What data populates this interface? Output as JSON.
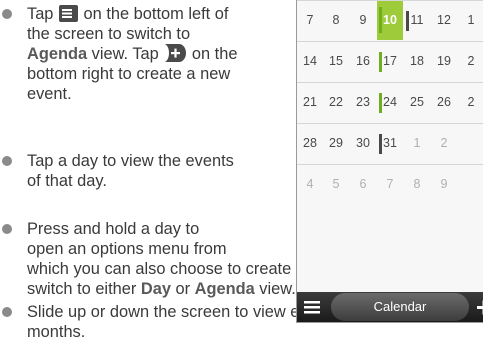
{
  "bullets": [
    {
      "lines": [
        {
          "parts": [
            {
              "t": "Tap "
            },
            {
              "icon": "menu-icon"
            },
            {
              "t": " on the bottom left of"
            }
          ]
        },
        {
          "parts": [
            {
              "t": "the screen to switch to"
            }
          ]
        },
        {
          "parts": [
            {
              "t": "Agenda",
              "b": true
            },
            {
              "t": " view. Tap "
            },
            {
              "icon": "plus-icon"
            },
            {
              "t": " on the"
            }
          ]
        },
        {
          "parts": [
            {
              "t": "bottom right to create a new"
            }
          ]
        },
        {
          "parts": [
            {
              "t": "event."
            }
          ]
        }
      ]
    },
    {
      "lines": [
        {
          "parts": [
            {
              "t": "Tap a day to view the events"
            }
          ]
        },
        {
          "parts": [
            {
              "t": "of that day."
            }
          ]
        }
      ]
    },
    {
      "lines": [
        {
          "parts": [
            {
              "t": "Press and hold a day to"
            }
          ]
        },
        {
          "parts": [
            {
              "t": "open an options menu from"
            }
          ]
        },
        {
          "parts": [
            {
              "t": "which you can also choose to create an event or"
            }
          ],
          "outdent": true
        },
        {
          "parts": [
            {
              "t": "switch to either "
            },
            {
              "t": "Day",
              "b": true
            },
            {
              "t": " or "
            },
            {
              "t": "Agenda",
              "b": true
            },
            {
              "t": " view."
            }
          ],
          "outdent": true
        }
      ]
    },
    {
      "lines": [
        {
          "parts": [
            {
              "t": "Slide up or down the screen to view earlier or later"
            }
          ]
        },
        {
          "parts": [
            {
              "t": "months."
            }
          ]
        }
      ]
    }
  ],
  "calendar": {
    "rows": [
      {
        "cells": [
          {
            "d": "7"
          },
          {
            "d": "8"
          },
          {
            "d": "9"
          },
          {
            "d": "10",
            "today": true,
            "ev": "green"
          },
          {
            "d": "11",
            "ev": "dark"
          },
          {
            "d": "12"
          },
          {
            "d": "1"
          }
        ]
      },
      {
        "cells": [
          {
            "d": "14"
          },
          {
            "d": "15"
          },
          {
            "d": "16"
          },
          {
            "d": "17",
            "ev": "green"
          },
          {
            "d": "18"
          },
          {
            "d": "19"
          },
          {
            "d": "2"
          }
        ]
      },
      {
        "cells": [
          {
            "d": "21"
          },
          {
            "d": "22"
          },
          {
            "d": "23"
          },
          {
            "d": "24",
            "ev": "green"
          },
          {
            "d": "25"
          },
          {
            "d": "26"
          },
          {
            "d": "2"
          }
        ]
      },
      {
        "cells": [
          {
            "d": "28"
          },
          {
            "d": "29"
          },
          {
            "d": "30"
          },
          {
            "d": "31",
            "ev": "dark"
          },
          {
            "d": "1",
            "dim": true
          },
          {
            "d": "2",
            "dim": true
          },
          {
            "d": "",
            "dim": true
          }
        ]
      },
      {
        "cells": [
          {
            "d": "4",
            "dim": true
          },
          {
            "d": "5",
            "dim": true
          },
          {
            "d": "6",
            "dim": true
          },
          {
            "d": "7",
            "dim": true
          },
          {
            "d": "8",
            "dim": true
          },
          {
            "d": "9",
            "dim": true
          },
          {
            "d": "",
            "dim": true
          }
        ]
      }
    ],
    "bottom_bar": {
      "title": "Calendar",
      "menu_icon": "menu-icon",
      "add_icon": "plus-icon"
    }
  }
}
